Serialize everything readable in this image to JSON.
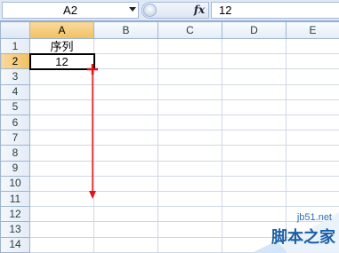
{
  "formula_bar": {
    "name_box": "A2",
    "fx_label": "fx",
    "formula_value": "12"
  },
  "columns": [
    "A",
    "B",
    "C",
    "D",
    "E"
  ],
  "active_column": "A",
  "rows": [
    "1",
    "2",
    "3",
    "4",
    "5",
    "6",
    "7",
    "8",
    "9",
    "10",
    "11",
    "12",
    "13",
    "14"
  ],
  "active_row": "2",
  "cells": {
    "A1": "序列",
    "A2": "12"
  },
  "selected_cell": "A2",
  "drag_color": "#e0141a",
  "watermark": {
    "site": "jb51.net",
    "name": "脚本之家"
  }
}
